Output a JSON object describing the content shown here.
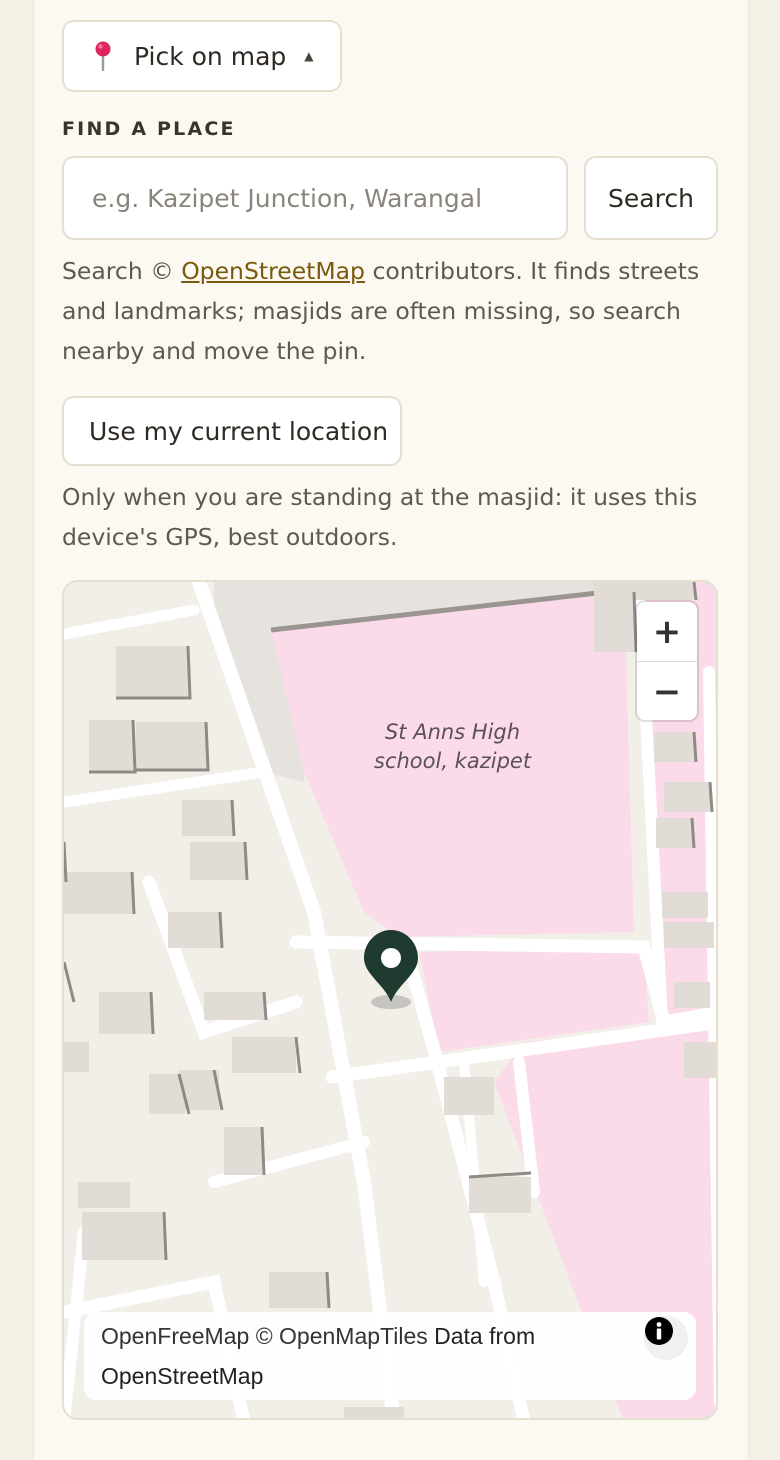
{
  "picker": {
    "mode_label": "Pick on map",
    "caret": "▲"
  },
  "find": {
    "label": "FIND A PLACE",
    "placeholder": "e.g. Kazipet Junction, Warangal",
    "search_label": "Search"
  },
  "notes": {
    "search_prefix": "Search © ",
    "search_link": "OpenStreetMap",
    "search_suffix": " contributors. It finds streets and landmarks; masjids are often missing, so search nearby and move the pin.",
    "location_button": "Use my current location",
    "location_note": "Only when you are standing at the masjid: it uses this device's GPS, best outdoors."
  },
  "map": {
    "place_label_line1": "St Anns High",
    "place_label_line2": "school, kazipet",
    "zoom_in": "+",
    "zoom_out": "−",
    "attribution_part1": "OpenFreeMap © OpenMapTiles",
    "attribution_part2": " Data from OpenStreetMap",
    "pin_color": "#1f3a2e",
    "school_color": "#fbdbe9"
  }
}
